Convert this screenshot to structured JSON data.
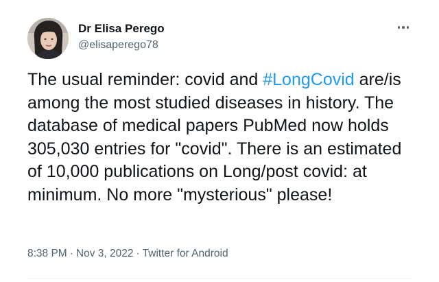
{
  "author": {
    "display_name": "Dr Elisa Perego",
    "handle": "@elisaperego78"
  },
  "more_icon": "more-horizontal-icon",
  "tweet": {
    "text_before": "The usual reminder: covid and ",
    "hashtag": "#LongCovid",
    "text_after": " are/is among the most studied diseases in history. The database of medical papers PubMed now holds 305,030 entries for \"covid\". There is an estimated of 10,000 publications on Long/post covid: at minimum. No more \"mysterious\" please!"
  },
  "meta": {
    "time": "8:38 PM",
    "separator": "·",
    "date": "Nov 3, 2022",
    "source": "Twitter for Android"
  },
  "colors": {
    "link": "#1d9bf0",
    "secondary_text": "#536471",
    "primary_text": "#0f1419"
  }
}
